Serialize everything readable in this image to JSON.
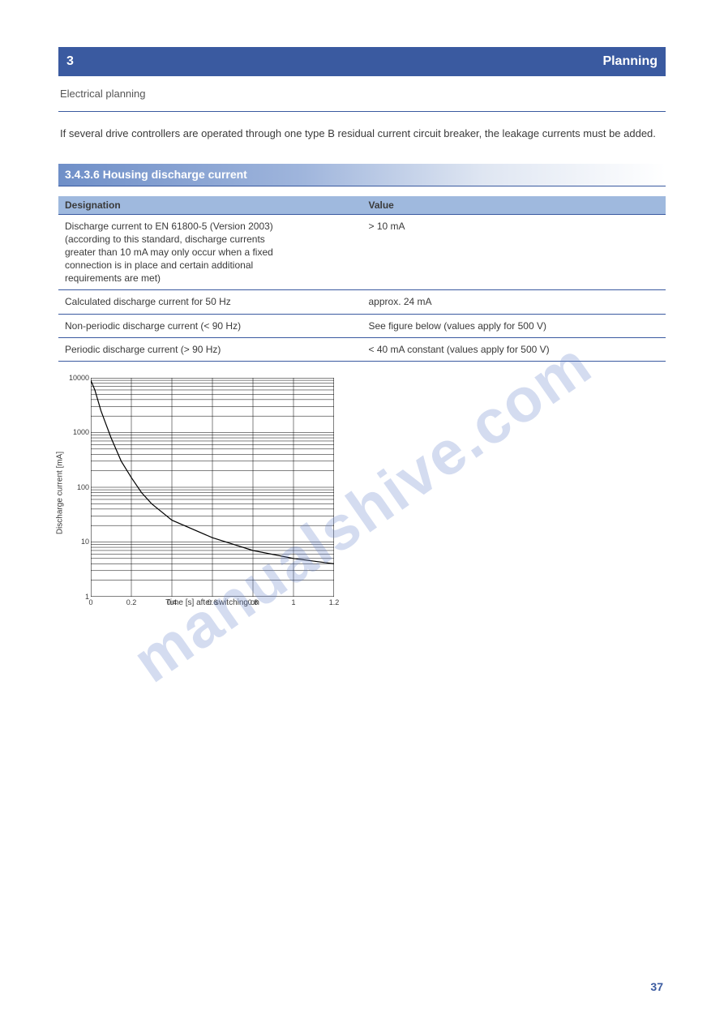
{
  "header": {
    "section_number": "3",
    "section_title": "Planning"
  },
  "subheader": "Electrical planning",
  "body_note": "If several drive controllers are operated through one type B residual current circuit breaker, the\nleakage currents must be added.",
  "section": {
    "title": "3.4.3.6 Housing discharge current"
  },
  "table": {
    "headers": [
      "Designation",
      "Value"
    ],
    "rows": [
      {
        "label": "Discharge current to EN 61800-5 (Version 2003)\n(according to this standard, discharge currents\ngreater than 10 mA may only occur when a fixed\nconnection is in place and certain additional\nrequirements are met)",
        "value": "> 10 mA"
      },
      {
        "label": "Calculated discharge current for 50 Hz",
        "value": "approx. 24 mA"
      },
      {
        "label": "Non-periodic discharge current (< 90 Hz)",
        "value": "See figure below (values apply for 500 V)"
      },
      {
        "label": "Periodic discharge current (> 90 Hz)",
        "value": "< 40 mA constant (values apply for 500 V)"
      }
    ]
  },
  "chart_data": {
    "type": "line",
    "title": "",
    "xlabel": "Time [s] after switching on",
    "ylabel": "Discharge current [mA]",
    "xlim": [
      0,
      1.2
    ],
    "ylim": [
      1,
      10000
    ],
    "yscale": "log",
    "xticks": [
      0,
      0.2,
      0.4,
      0.6,
      0.8,
      1,
      1.2
    ],
    "yticks": [
      1,
      10,
      100,
      1000,
      10000
    ],
    "series": [
      {
        "name": "discharge current",
        "x": [
          0.0,
          0.02,
          0.05,
          0.1,
          0.15,
          0.2,
          0.25,
          0.3,
          0.4,
          0.6,
          0.8,
          1.0,
          1.2
        ],
        "values": [
          9000,
          6000,
          2500,
          800,
          300,
          150,
          80,
          50,
          25,
          12,
          7,
          5,
          4
        ]
      }
    ]
  },
  "page_number": "37",
  "watermark": "manualshive.com"
}
